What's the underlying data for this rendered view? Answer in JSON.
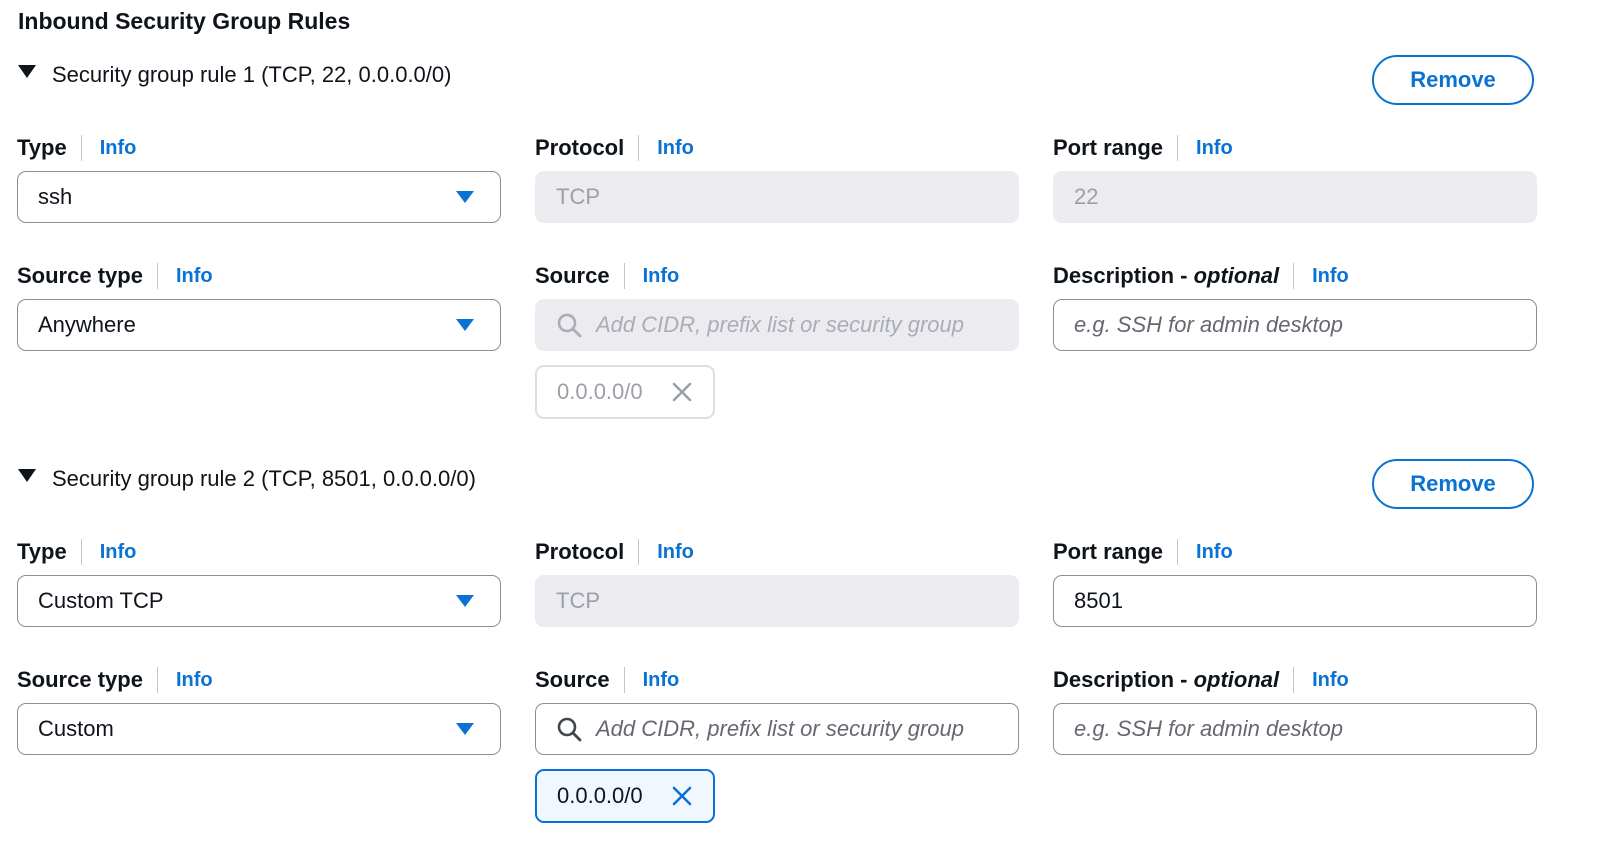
{
  "section_title": "Inbound Security Group Rules",
  "info_label": "Info",
  "rules": [
    {
      "header": "Security group rule 1 (TCP, 22, 0.0.0.0/0)",
      "remove_label": "Remove",
      "type": {
        "label": "Type",
        "value": "ssh"
      },
      "protocol": {
        "label": "Protocol",
        "value": "TCP"
      },
      "port_range": {
        "label": "Port range",
        "value": "22"
      },
      "source_type": {
        "label": "Source type",
        "value": "Anywhere"
      },
      "source": {
        "label": "Source",
        "placeholder": "Add CIDR, prefix list or security group",
        "token": "0.0.0.0/0"
      },
      "description": {
        "label": "Description - ",
        "label_italic": "optional",
        "placeholder": "e.g. SSH for admin desktop"
      }
    },
    {
      "header": "Security group rule 2 (TCP, 8501, 0.0.0.0/0)",
      "remove_label": "Remove",
      "type": {
        "label": "Type",
        "value": "Custom TCP"
      },
      "protocol": {
        "label": "Protocol",
        "value": "TCP"
      },
      "port_range": {
        "label": "Port range",
        "value": "8501"
      },
      "source_type": {
        "label": "Source type",
        "value": "Custom"
      },
      "source": {
        "label": "Source",
        "placeholder": "Add CIDR, prefix list or security group",
        "token": "0.0.0.0/0"
      },
      "description": {
        "label": "Description - ",
        "label_italic": "optional",
        "placeholder": "e.g. SSH for admin desktop"
      }
    }
  ],
  "colors": {
    "accent": "#0972d3",
    "disabled_fill": "#ebebf0",
    "text": "#0f141a"
  },
  "icons": [
    "caret-down-icon",
    "dropdown-arrow-icon",
    "search-icon",
    "dismiss-icon"
  ]
}
